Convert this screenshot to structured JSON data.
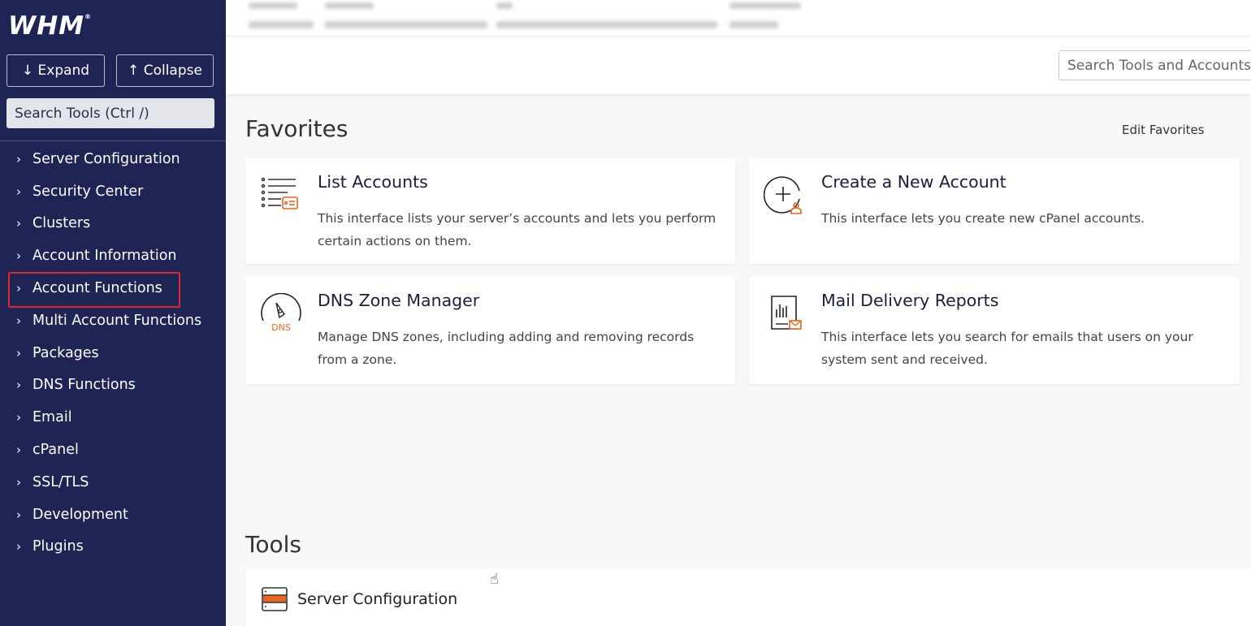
{
  "sidebar": {
    "logo": "WHM",
    "expand_label": "↓ Expand",
    "collapse_label": "↑ Collapse",
    "search_placeholder": "Search Tools (Ctrl /)",
    "items": [
      {
        "label": "Server Configuration"
      },
      {
        "label": "Security Center"
      },
      {
        "label": "Clusters"
      },
      {
        "label": "Account Information"
      },
      {
        "label": "Account Functions",
        "highlighted": true
      },
      {
        "label": "Multi Account Functions"
      },
      {
        "label": "Packages"
      },
      {
        "label": "DNS Functions"
      },
      {
        "label": "Email"
      },
      {
        "label": "cPanel"
      },
      {
        "label": "SSL/TLS"
      },
      {
        "label": "Development"
      },
      {
        "label": "Plugins"
      }
    ]
  },
  "toolbar": {
    "search_placeholder": "Search Tools and Accounts"
  },
  "favorites": {
    "title": "Favorites",
    "edit_label": "Edit Favorites",
    "cards": [
      {
        "title": "List Accounts",
        "description": "This interface lists your server’s accounts and lets you perform certain actions on them.",
        "icon": "list-accounts-icon"
      },
      {
        "title": "Create a New Account",
        "description": "This interface lets you create new cPanel accounts.",
        "icon": "create-account-icon"
      },
      {
        "title": "DNS Zone Manager",
        "description": "Manage DNS zones, including adding and removing records from a zone.",
        "icon": "dns-icon",
        "icon_text": "DNS"
      },
      {
        "title": "Mail Delivery Reports",
        "description": "This interface lets you search for emails that users on your system sent and received.",
        "icon": "mail-report-icon"
      }
    ]
  },
  "tools": {
    "title": "Tools",
    "first_group": "Server Configuration"
  },
  "colors": {
    "sidebar_bg": "#1e2454",
    "accent_orange": "#e8661f",
    "highlight_red": "#d8262e"
  }
}
